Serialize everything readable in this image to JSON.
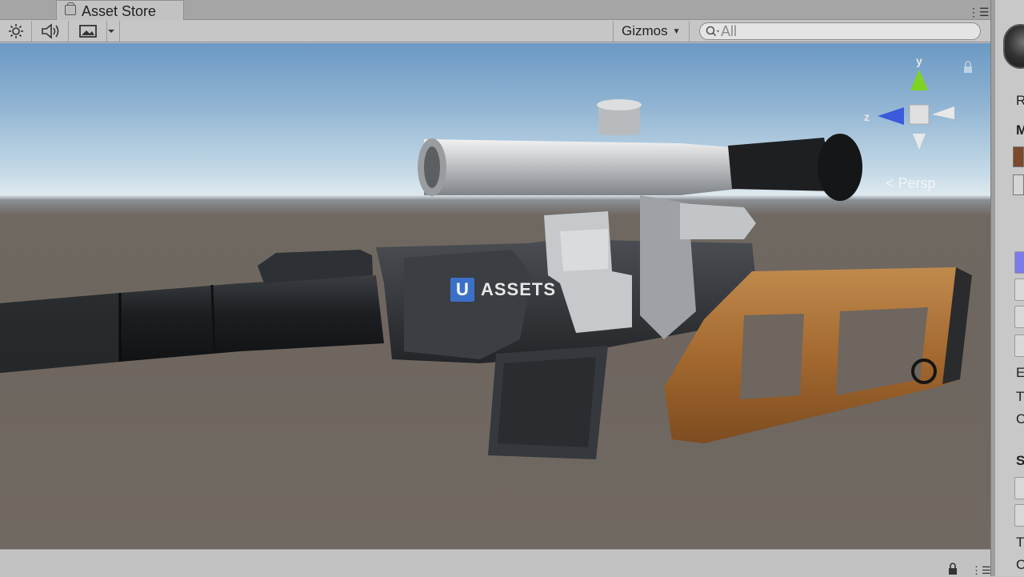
{
  "window": {
    "tab_title": "Asset Store",
    "tab_icon": "shopping-bag-icon",
    "menu_icon": "tab-menu-icon"
  },
  "toolbar": {
    "light_icon": "sun-icon",
    "audio_icon": "speaker-icon",
    "fx_icon": "image-icon",
    "fx_dropdown_icon": "chevron-down-icon",
    "gizmos_label": "Gizmos",
    "search_placeholder": "All"
  },
  "viewport": {
    "watermark_letter": "U",
    "watermark_text": "ASSETS",
    "projection_label": "Persp",
    "gizmo_axes": {
      "y": "y",
      "z": "z"
    },
    "colors": {
      "y_axis": "#7ed321",
      "z_axis": "#3b5bdb",
      "x_axis": "#e8e8e8",
      "sky_top": "#6b99c4",
      "ground": "#6e665f"
    }
  },
  "inspector": {
    "letters": [
      "R",
      "M",
      "E",
      "T",
      "C",
      "S",
      "T",
      "C"
    ]
  }
}
